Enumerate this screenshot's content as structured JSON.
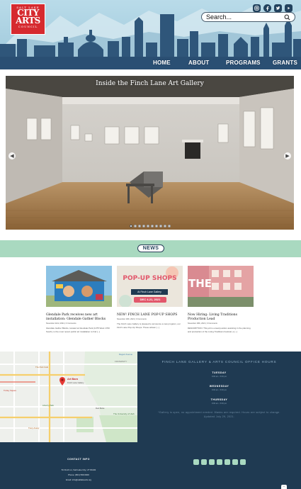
{
  "header": {
    "logo": {
      "line1": "SALT LAKE",
      "line2a": "CITY",
      "line2b": "ARTS",
      "line3": "COUNCIL"
    },
    "social_icons": [
      "instagram-icon",
      "facebook-icon",
      "twitter-icon",
      "youtube-icon"
    ],
    "search": {
      "placeholder": "Search..."
    },
    "nav": [
      {
        "label": "HOME"
      },
      {
        "label": "ABOUT"
      },
      {
        "label": "PROGRAMS"
      },
      {
        "label": "GRANTS"
      }
    ]
  },
  "slider": {
    "caption": "Inside the Finch Lane Art Gallery",
    "total_slides": 10,
    "active_slide": 1
  },
  "news": {
    "heading": "NEWS",
    "items": [
      {
        "title": "Glendale Park receives new art installation: Glendale Gather Blocks",
        "meta_date": "November 22nd, 2021",
        "meta_comments": "0 Comments",
        "excerpt": "Glendale Gather Blocks, located at Glendale Park (1375 West 1700 South), is the most recent public art installation to find [...]"
      },
      {
        "title": "NEW! FINCH LANE POP-UP SHOPS",
        "meta_date": "November 19th, 2021",
        "meta_comments": "0 Comments",
        "excerpt": "The Finch Lane Gallery is pleased to announce a new program, our Finch Lane Pop-Up Shops. These artisan [...]",
        "image_text": {
          "line1": "POP-UP SHOPS",
          "line2": "At Finch Lane Gallery",
          "line3": "DEC 4-21, 2021"
        }
      },
      {
        "title": "Now Hiring: Living Traditions Production Lead",
        "meta_date": "November 18th, 2021",
        "meta_comments": "0 Comments",
        "excerpt": "DESCRIPTION: This job is a lead position assisting in the planning and production of the Living Traditions Festival, a [...]",
        "image_text": "THE"
      }
    ]
  },
  "hours": {
    "title": "FINCH LANE GALLERY & ARTS COUNCIL OFFICE HOURS",
    "days": [
      {
        "day": "TUESDAY",
        "time": "9:00 am - 5:00 pm"
      },
      {
        "day": "WEDNESDAY",
        "time": "9:00 am - 5:00 pm"
      },
      {
        "day": "THURSDAY",
        "time": "9:00 am - 5:00 pm"
      }
    ],
    "note": "*Gallery is open, no appointment needed. Masks are required. Hours are subject to change. Updated July 29, 2021."
  },
  "map": {
    "pin_label": "Art Barn",
    "pin_sublabel": "Finch Lane Gallery",
    "labels": [
      "Regent Avenue",
      "FRATERNITY",
      "Liberty Park",
      "The University of Utah",
      "Red Butte",
      "The Park Café",
      "Trolley Square",
      "Tracy Aviary"
    ]
  },
  "footer": {
    "contact_title": "CONTACT INFO",
    "address": "54 Finch Ln, Salt Lake City, UT 84102",
    "phone": "Phone: (801) 596-5000",
    "email": "Email: info@saltlakearts.org",
    "social_icons": [
      "facebook-icon",
      "instagram-icon",
      "twitter-icon",
      "youtube-icon",
      "podcast-icon",
      "flickr-icon",
      "phone-icon"
    ]
  }
}
